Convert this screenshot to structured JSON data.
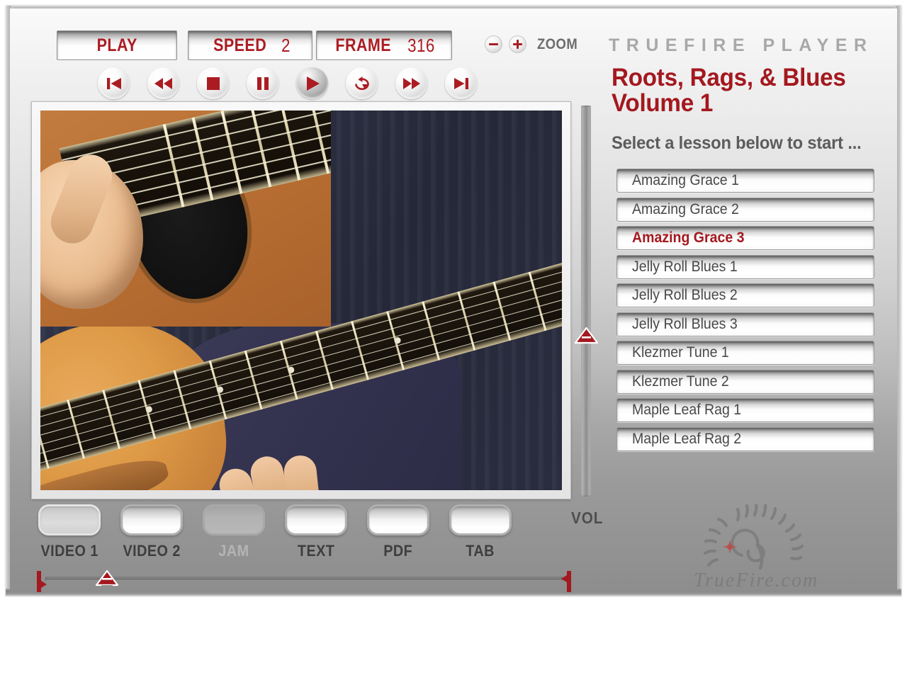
{
  "app": {
    "brand": "T R U E F I R E   P L A Y E R",
    "brand_plain": "TRUEFIRE PLAYER"
  },
  "transport_readouts": {
    "play": {
      "label": "PLAY",
      "value": ""
    },
    "speed": {
      "label": "SPEED",
      "value": "2"
    },
    "frame": {
      "label": "FRAME",
      "value": "316"
    }
  },
  "zoom": {
    "minus_label": "−",
    "plus_label": "+",
    "label": "ZOOM"
  },
  "transport_buttons": [
    {
      "name": "skip-to-start",
      "icon": "skip-back-icon",
      "active": false
    },
    {
      "name": "rewind",
      "icon": "rewind-icon",
      "active": false
    },
    {
      "name": "stop",
      "icon": "stop-icon",
      "active": false
    },
    {
      "name": "pause",
      "icon": "pause-icon",
      "active": false
    },
    {
      "name": "play",
      "icon": "play-icon",
      "active": true
    },
    {
      "name": "loop",
      "icon": "loop-icon",
      "active": false
    },
    {
      "name": "fast-forward",
      "icon": "fast-forward-icon",
      "active": false
    },
    {
      "name": "skip-to-end",
      "icon": "skip-forward-icon",
      "active": false
    }
  ],
  "course": {
    "title_line1": "Roots, Rags, & Blues",
    "title_line2": "Volume 1",
    "subtitle": "Select a lesson below to start ..."
  },
  "lessons": [
    {
      "label": "Amazing Grace 1",
      "selected": false
    },
    {
      "label": "Amazing Grace 2",
      "selected": false
    },
    {
      "label": "Amazing Grace 3",
      "selected": true
    },
    {
      "label": "Jelly Roll Blues 1",
      "selected": false
    },
    {
      "label": "Jelly Roll Blues 2",
      "selected": false
    },
    {
      "label": "Jelly Roll Blues 3",
      "selected": false
    },
    {
      "label": "Klezmer Tune 1",
      "selected": false
    },
    {
      "label": "Klezmer Tune 2",
      "selected": false
    },
    {
      "label": "Maple Leaf Rag 1",
      "selected": false
    },
    {
      "label": "Maple Leaf Rag 2",
      "selected": false
    }
  ],
  "dock_tabs": [
    {
      "label": "VIDEO 1",
      "state": "selected"
    },
    {
      "label": "VIDEO 2",
      "state": "enabled"
    },
    {
      "label": "JAM",
      "state": "disabled"
    },
    {
      "label": "TEXT",
      "state": "enabled"
    },
    {
      "label": "PDF",
      "state": "enabled"
    },
    {
      "label": "TAB",
      "state": "enabled"
    }
  ],
  "volume": {
    "label": "VOL"
  },
  "logo": {
    "text": "TrueFire.com"
  },
  "colors": {
    "accent_red": "#a4181f",
    "control_red": "#ab1c22",
    "brand_gray": "#a8a8a8",
    "panel_gray": "#9a9a9a",
    "lesson_text": "#484848"
  }
}
